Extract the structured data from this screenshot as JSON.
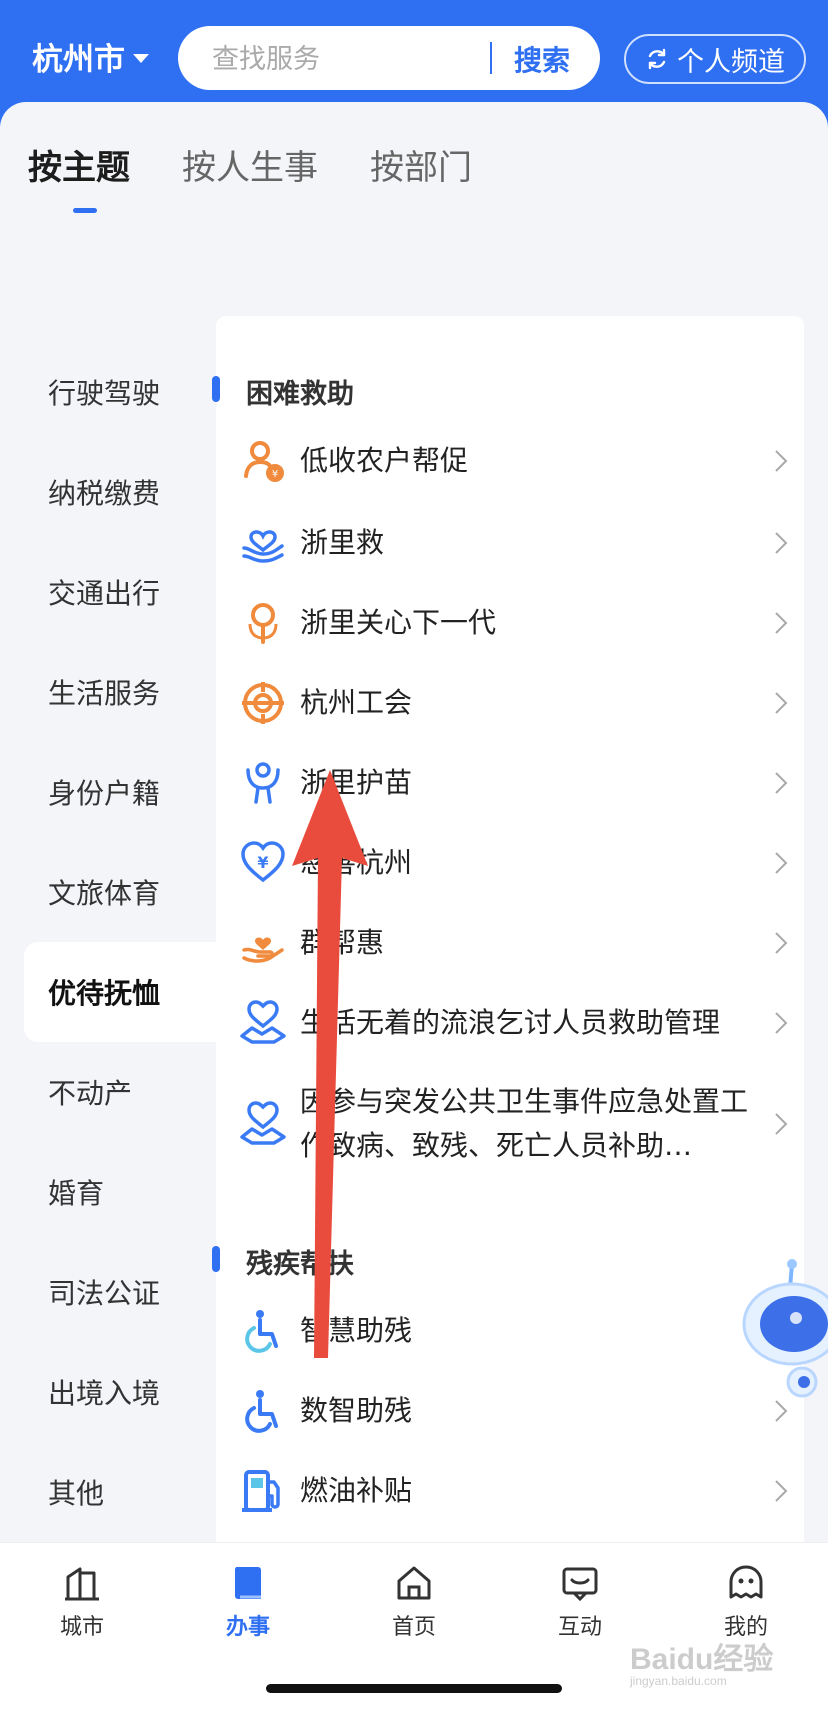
{
  "header": {
    "city": "杭州市",
    "search_placeholder": "查找服务",
    "search_button": "搜索",
    "channel_button": "个人频道"
  },
  "tabs": [
    "按主题",
    "按人生事",
    "按部门"
  ],
  "sidebar": {
    "items": [
      "行驶驾驶",
      "纳税缴费",
      "交通出行",
      "生活服务",
      "身份户籍",
      "文旅体育",
      "优待抚恤",
      "不动产",
      "婚育",
      "司法公证",
      "出境入境",
      "其他"
    ],
    "active": "优待抚恤"
  },
  "sections": [
    {
      "title": "困难救助",
      "items": [
        {
          "label": "低收农户帮促",
          "icon": "person-yuan-icon"
        },
        {
          "label": "浙里救",
          "icon": "hands-heart-icon"
        },
        {
          "label": "浙里关心下一代",
          "icon": "person-ring-icon"
        },
        {
          "label": "杭州工会",
          "icon": "union-emblem-icon"
        },
        {
          "label": "浙里护苗",
          "icon": "child-protect-icon"
        },
        {
          "label": "慈善杭州",
          "icon": "heart-yuan-icon"
        },
        {
          "label": "群帮惠",
          "icon": "hand-heart-icon"
        },
        {
          "label": "生活无着的流浪乞讨人员救助管理",
          "icon": "heart-handshake-icon"
        },
        {
          "label": "因参与突发公共卫生事件应急处置工作致病、致残、死亡人员补助…",
          "icon": "heart-handshake-icon"
        }
      ]
    },
    {
      "title": "残疾帮扶",
      "items": [
        {
          "label": "智慧助残",
          "icon": "wheelchair-icon"
        },
        {
          "label": "数智助残",
          "icon": "wheelchair-icon"
        },
        {
          "label": "燃油补贴",
          "icon": "fuel-pump-icon"
        }
      ]
    }
  ],
  "bottom_nav": {
    "items": [
      "城市",
      "办事",
      "首页",
      "互动",
      "我的"
    ],
    "active": "办事"
  },
  "watermark": {
    "text": "Baidu经验",
    "sub": "jingyan.baidu.com"
  },
  "colors": {
    "brand": "#2f6ff2",
    "orange": "#f08a3c",
    "blue_icon": "#3a7bf5",
    "arrow": "#e94b3c"
  }
}
